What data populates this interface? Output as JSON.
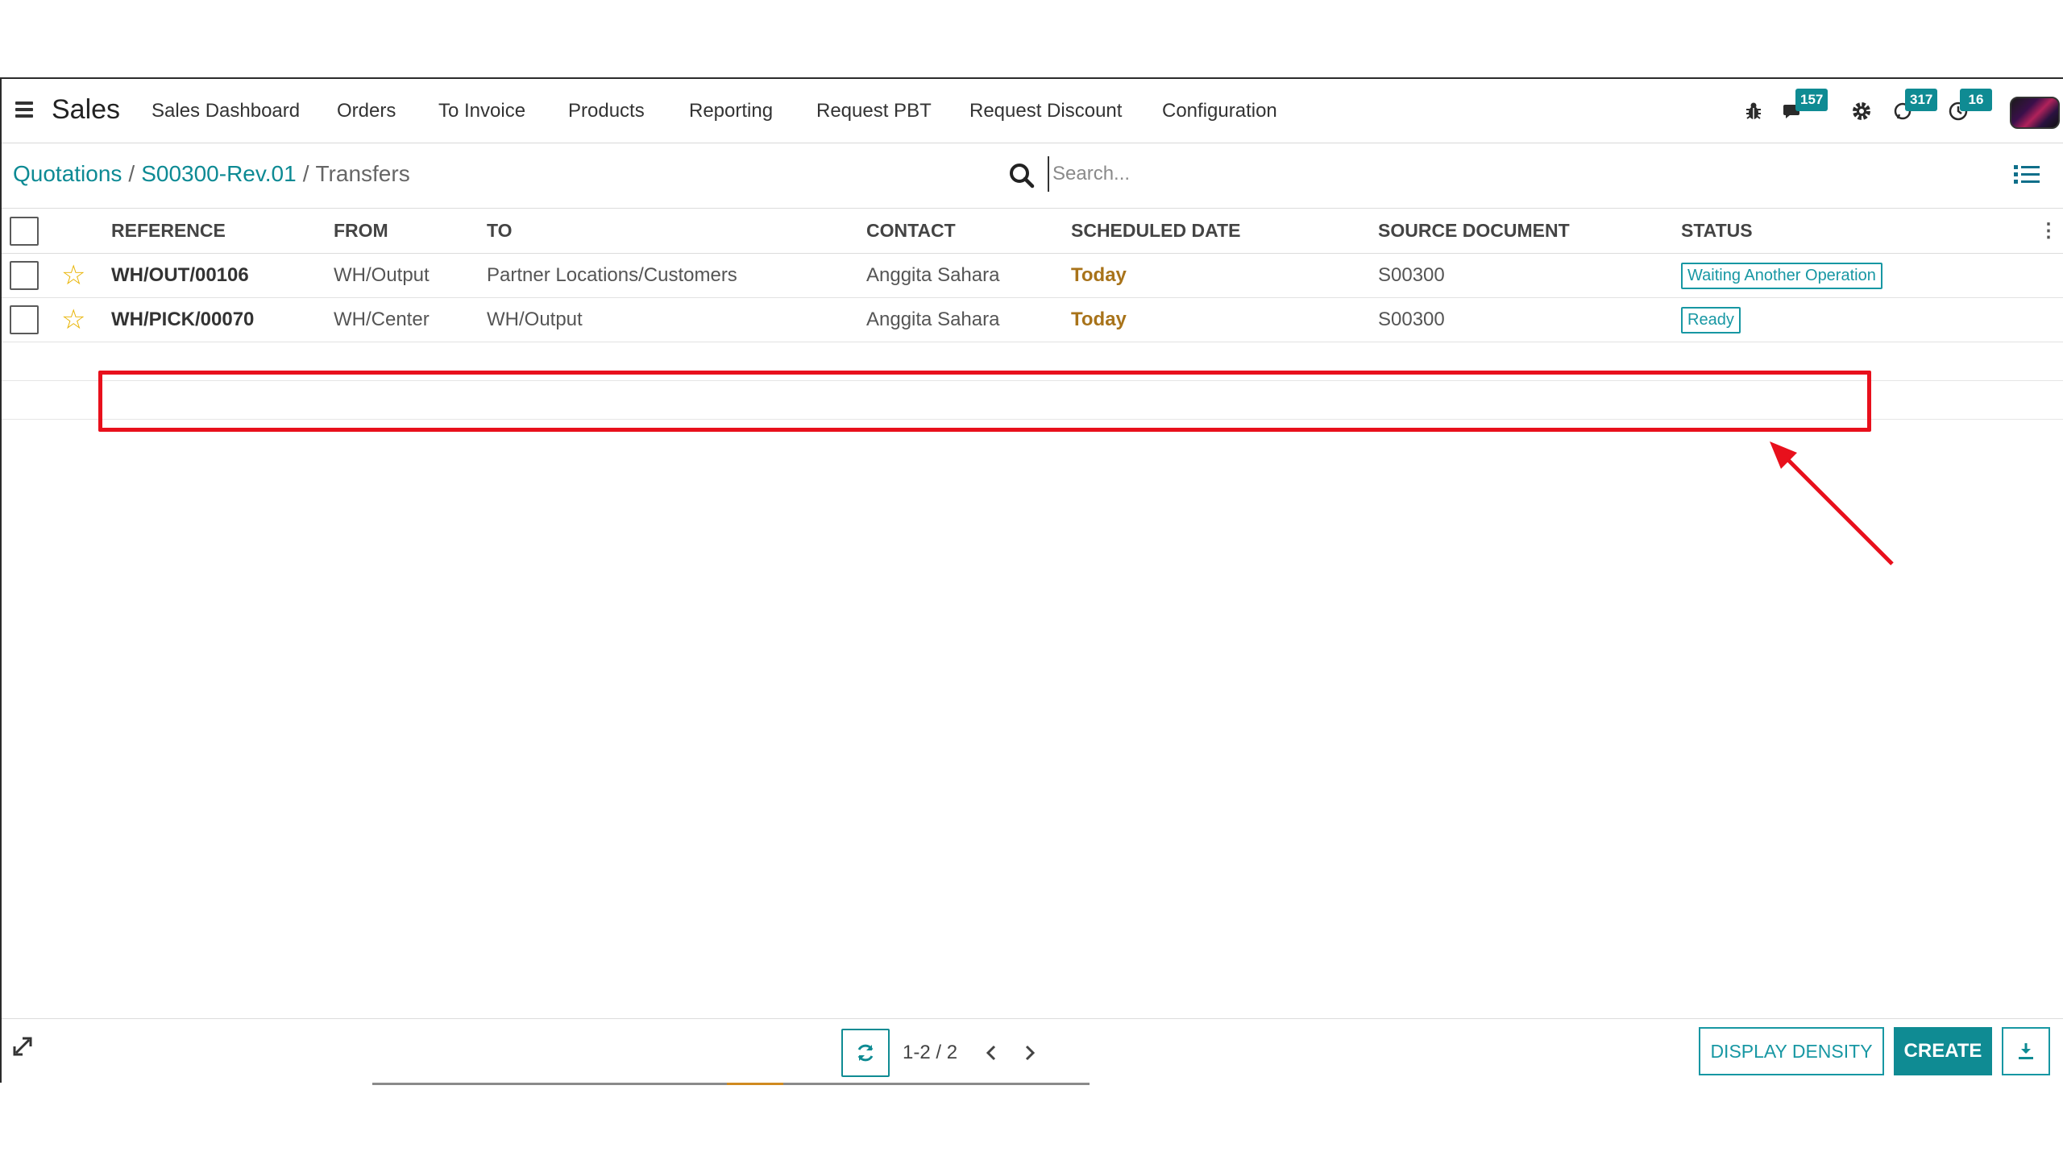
{
  "app": {
    "title": "Sales"
  },
  "menu": {
    "items": [
      "Sales Dashboard",
      "Orders",
      "To Invoice",
      "Products",
      "Reporting",
      "Request PBT",
      "Request Discount",
      "Configuration"
    ]
  },
  "systray": {
    "messages_badge": "157",
    "activity_badge": "317",
    "clock_badge": "16"
  },
  "breadcrumb": {
    "parts": [
      "Quotations",
      "S00300-Rev.01"
    ],
    "separator": "/",
    "current": "Transfers"
  },
  "search": {
    "placeholder": "Search..."
  },
  "table": {
    "headers": [
      "REFERENCE",
      "FROM",
      "TO",
      "CONTACT",
      "SCHEDULED DATE",
      "SOURCE DOCUMENT",
      "STATUS"
    ],
    "rows": [
      {
        "reference": "WH/OUT/00106",
        "from": "WH/Output",
        "to": "Partner Locations/Customers",
        "contact": "Anggita Sahara",
        "scheduled": "Today",
        "source": "S00300",
        "status": "Waiting Another Operation"
      },
      {
        "reference": "WH/PICK/00070",
        "from": "WH/Center",
        "to": "WH/Output",
        "contact": "Anggita Sahara",
        "scheduled": "Today",
        "source": "S00300",
        "status": "Ready"
      }
    ]
  },
  "pager": {
    "value": "1-2 / 2"
  },
  "buttons": {
    "display_density": "DISPLAY DENSITY",
    "create": "CREATE"
  },
  "colors": {
    "accent": "#0f8b93",
    "status_border": "#1797a3",
    "today": "#a8731a",
    "annotation": "#e8101c",
    "star": "#e8b300"
  }
}
